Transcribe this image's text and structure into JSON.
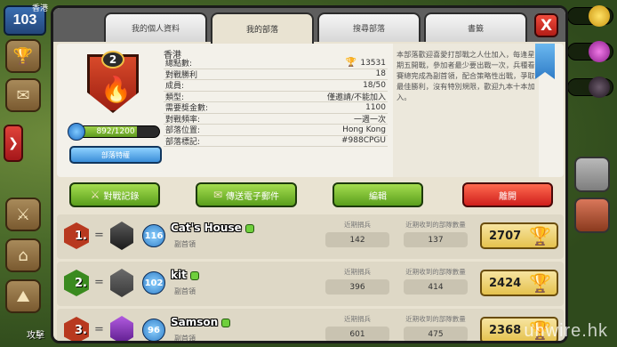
{
  "left_rail": {
    "hk_label": "香港",
    "xp_level": "103",
    "attack_label": "攻擊"
  },
  "tabs": [
    {
      "label": "我的個人資料"
    },
    {
      "label": "我的部落"
    },
    {
      "label": "搜尋部落"
    },
    {
      "label": "書籤"
    }
  ],
  "active_tab": 1,
  "close_label": "X",
  "clan": {
    "level": "2",
    "xp_text": "892/1200",
    "xp_fraction": 0.743,
    "perks_label": "部落特權",
    "region_name": "香港",
    "stats": [
      {
        "label": "總點數:",
        "value": "13531",
        "icon": "trophy"
      },
      {
        "label": "對戰勝利",
        "value": "18"
      },
      {
        "label": "成員:",
        "value": "18/50"
      },
      {
        "label": "類型:",
        "value": "僅邀請/不能加入"
      },
      {
        "label": "需要獎金數:",
        "value": "1100"
      },
      {
        "label": "對戰頻率:",
        "value": "一週一次"
      },
      {
        "label": "部落位置:",
        "value": "Hong Kong"
      },
      {
        "label": "部落標記:",
        "value": "#988CPGU"
      }
    ],
    "description": "本部落歡迎喜愛打部戰之人仕加入，每逢星期五開戰，參加者最少要出戰一次，兵種看賽總完成為副首領，配合策略性出戰，爭取最佳勝利，沒有特別規限，歡迎九本十本加入。"
  },
  "actions": [
    {
      "label": "對戰記錄",
      "icon": "swords-icon"
    },
    {
      "label": "傳送電子郵件",
      "icon": "mail-icon"
    },
    {
      "label": "編輯",
      "icon": ""
    },
    {
      "label": "離開",
      "icon": ""
    }
  ],
  "members": [
    {
      "rank": "1.",
      "level": "116",
      "name": "Cat's House",
      "role": "副首領",
      "donated_label": "近期捐兵",
      "donated": "142",
      "received_label": "近期收到的部隊數量",
      "received": "137",
      "trophies": "2707"
    },
    {
      "rank": "2.",
      "level": "102",
      "name": "kit",
      "role": "副首領",
      "donated_label": "近期捐兵",
      "donated": "396",
      "received_label": "近期收到的部隊數量",
      "received": "414",
      "trophies": "2424"
    },
    {
      "rank": "3.",
      "level": "96",
      "name": "Samson",
      "role": "副首領",
      "donated_label": "近期捐兵",
      "donated": "601",
      "received_label": "近期收到的部隊數量",
      "received": "475",
      "trophies": "2368"
    }
  ],
  "colors": {
    "accent_green": "#6fb52a",
    "accent_red": "#d9281f",
    "tab_bar": "#5e5e5e",
    "panel": "#e9e3d2"
  },
  "watermark": "unwire.hk"
}
